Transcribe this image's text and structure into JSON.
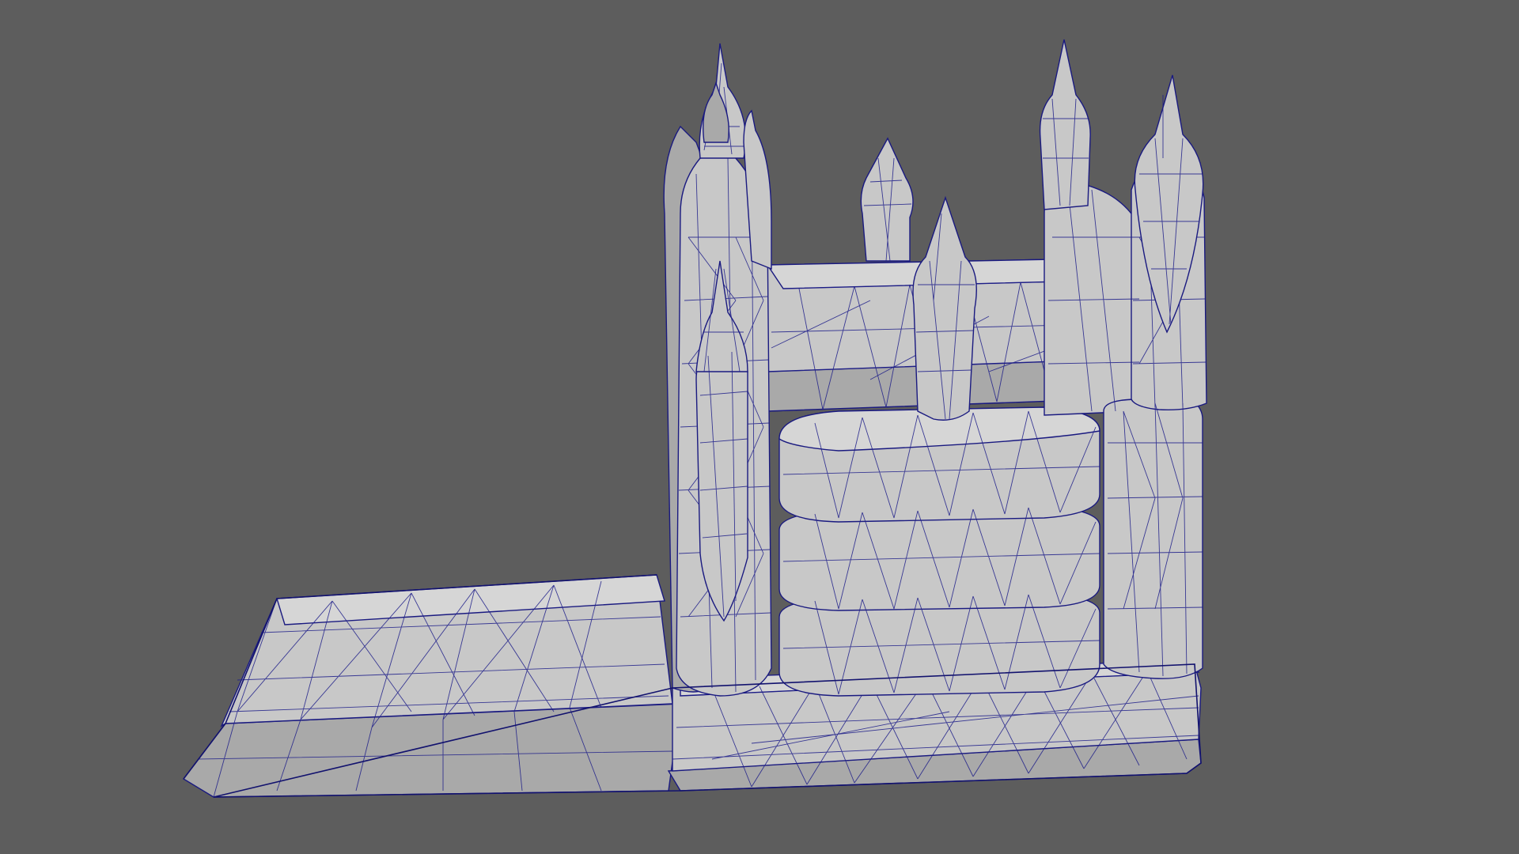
{
  "viewport": {
    "background_color": "#5d5d5d",
    "mesh_fill_color": "#c8c8c8",
    "wireframe_color": "#1a1a80",
    "display_mode": "wireframe-on-shaded",
    "model": "castle-mesh"
  }
}
